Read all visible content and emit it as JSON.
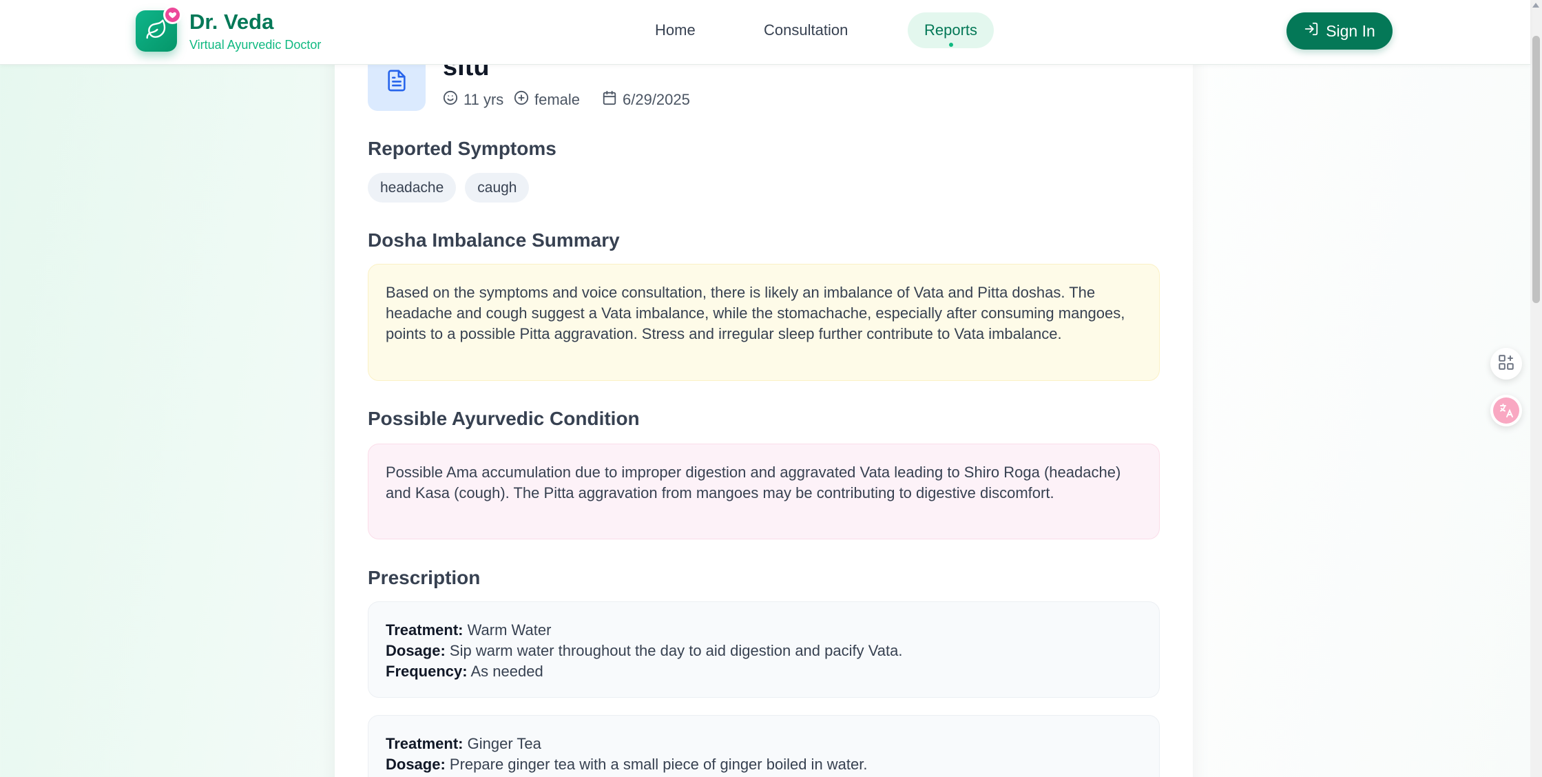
{
  "header": {
    "brand_name": "Dr. Veda",
    "brand_tagline": "Virtual Ayurvedic Doctor",
    "nav": [
      {
        "label": "Home",
        "active": false
      },
      {
        "label": "Consultation",
        "active": false
      },
      {
        "label": "Reports",
        "active": true
      }
    ],
    "sign_in_label": "Sign In"
  },
  "report": {
    "patient_name": "situ",
    "age": "11 yrs",
    "gender": "female",
    "date": "6/29/2025",
    "symptoms_title": "Reported Symptoms",
    "symptoms": [
      "headache",
      "caugh"
    ],
    "dosha_title": "Dosha Imbalance Summary",
    "dosha_text": "Based on the symptoms and voice consultation, there is likely an imbalance of Vata and Pitta doshas. The headache and cough suggest a Vata imbalance, while the stomachache, especially after consuming mangoes, points to a possible Pitta aggravation. Stress and irregular sleep further contribute to Vata imbalance.",
    "condition_title": "Possible Ayurvedic Condition",
    "condition_text": "Possible Ama accumulation due to improper digestion and aggravated Vata leading to Shiro Roga (headache) and Kasa (cough). The Pitta aggravation from mangoes may be contributing to digestive discomfort.",
    "prescription_title": "Prescription",
    "labels": {
      "treatment": "Treatment:",
      "dosage": "Dosage:",
      "frequency": "Frequency:"
    },
    "prescriptions": [
      {
        "treatment": "Warm Water",
        "dosage": "Sip warm water throughout the day to aid digestion and pacify Vata.",
        "frequency": "As needed"
      },
      {
        "treatment": "Ginger Tea",
        "dosage": "Prepare ginger tea with a small piece of ginger boiled in water."
      }
    ]
  },
  "colors": {
    "brand_green": "#047857",
    "accent_green": "#10b981",
    "heart_pink": "#ec4899",
    "dosha_bg": "#fefbe8",
    "condition_bg": "#fdf2f8"
  },
  "icons": [
    "leaf-icon",
    "heart-icon",
    "sign-in-icon",
    "document-icon",
    "face-icon",
    "gender-icon",
    "calendar-icon",
    "apps-icon",
    "translate-icon"
  ]
}
